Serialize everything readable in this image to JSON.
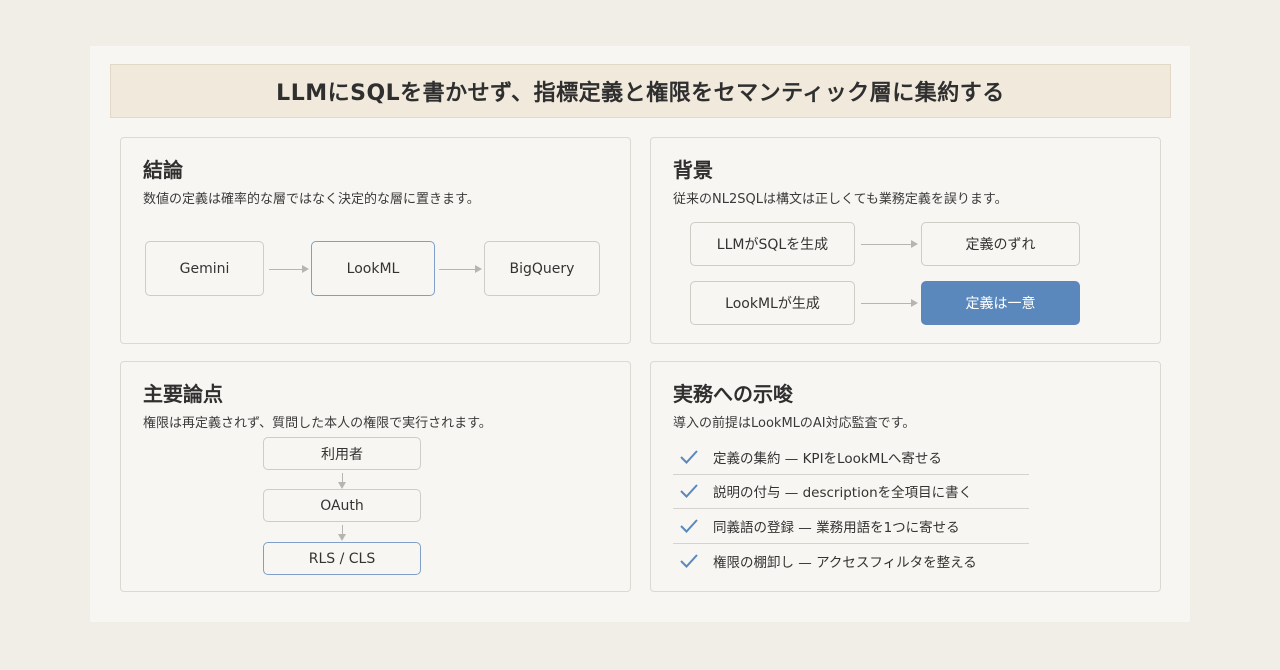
{
  "title": "LLMにSQLを書かせず、指標定義と権限をセマンティック層に集約する",
  "conclusion": {
    "heading": "結論",
    "subtitle": "数値の定義は確率的な層ではなく決定的な層に置きます。",
    "flow": [
      "Gemini",
      "LookML",
      "BigQuery"
    ]
  },
  "background": {
    "heading": "背景",
    "subtitle": "従来のNL2SQLは構文は正しくても業務定義を誤ります。",
    "rows": [
      {
        "from": "LLMがSQLを生成",
        "to": "定義のずれ"
      },
      {
        "from": "LookMLが生成",
        "to": "定義は一意"
      }
    ]
  },
  "key_points": {
    "heading": "主要論点",
    "subtitle": "権限は再定義されず、質問した本人の権限で実行されます。",
    "flow": [
      "利用者",
      "OAuth",
      "RLS / CLS"
    ]
  },
  "implications": {
    "heading": "実務への示唆",
    "subtitle": "導入の前提はLookMLのAI対応監査です。",
    "items": [
      "定義の集約 — KPIをLookMLへ寄せる",
      "説明の付与 — descriptionを全項目に書く",
      "同義語の登録 — 業務用語を1つに寄せる",
      "権限の棚卸し — アクセスフィルタを整える"
    ],
    "check_icon": "checkmark-icon"
  },
  "colors": {
    "accent": "#5a88bd",
    "highlight_border": "#7f9fc9",
    "title_band": "#f0e9dc"
  }
}
